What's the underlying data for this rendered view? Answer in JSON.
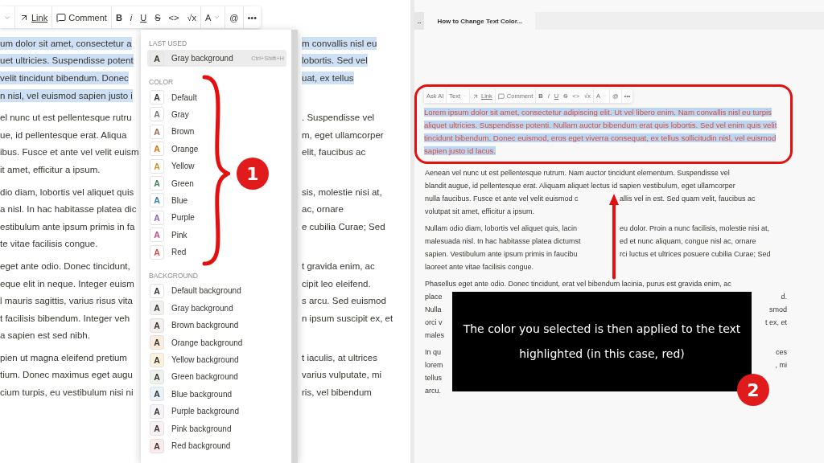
{
  "left_screenshot": {
    "toolbar": [
      [
        {
          "label": "Link",
          "kind": "link"
        }
      ],
      [
        {
          "label": "Comment",
          "kind": "comment"
        }
      ],
      [
        {
          "label": "B",
          "kind": "bold"
        },
        {
          "label": "i",
          "kind": "italic"
        },
        {
          "label": "U",
          "kind": "underline"
        },
        {
          "label": "S",
          "kind": "strike"
        },
        {
          "label": "<>",
          "kind": "plain"
        },
        {
          "label": "√x",
          "kind": "plain"
        }
      ],
      [
        {
          "label": "A",
          "kind": "dropdown"
        }
      ],
      [
        {
          "label": "@",
          "kind": "plain"
        }
      ],
      [
        {
          "label": "•••",
          "kind": "plain"
        }
      ]
    ],
    "paragraphs": [
      {
        "selected": true,
        "lines": [
          {
            "left": "um dolor sit amet, consectetur a",
            "right": "m convallis nisl eu"
          },
          {
            "left": "uet ultricies. Suspendisse potent",
            "right": "lobortis. Sed vel"
          },
          {
            "left": " velit tincidunt bibendum. Donec",
            "right": "uat, ex tellus"
          },
          {
            "left": "n nisl, vel euismod sapien justo i"
          }
        ]
      },
      {
        "selected": false,
        "lines": [
          {
            "left": "el nunc ut est pellentesque rutru",
            "right": ". Suspendisse vel"
          },
          {
            "left": "ue, id pellentesque erat. Aliqua",
            "right": "m, eget ullamcorper"
          },
          {
            "left": "ibus. Fusce et ante vel velit euism",
            "right": "elit, faucibus ac"
          },
          {
            "left": "it amet, efficitur a ipsum."
          }
        ]
      },
      {
        "selected": false,
        "lines": [
          {
            "left": "dio diam, lobortis vel aliquet quis",
            "right": "sis, molestie nisi at,"
          },
          {
            "left": "a nisl. In hac habitasse platea dic",
            "right": "ac, ornare"
          },
          {
            "left": "estibulum ante ipsum primis in fa",
            "right": "e cubilia Curae; Sed"
          },
          {
            "left": "te vitae facilisis congue."
          }
        ]
      },
      {
        "selected": false,
        "lines": [
          {
            "left": "eget ante odio. Donec tincidunt,",
            "right": "t gravida enim, ac"
          },
          {
            "left": "eque elit in neque. Integer euism",
            "right": "cipit leo eleifend."
          },
          {
            "left": "l mauris sagittis, varius risus vita",
            "right": "s arcu. Sed euismod"
          },
          {
            "left": "t facilisis bibendum. Integer veh",
            "right": "n ipsum suscipit ex, et"
          },
          {
            "left": "a sapien est sed nibh."
          }
        ]
      },
      {
        "selected": false,
        "lines": [
          {
            "left": "pien ut magna eleifend pretium",
            "right": "t iaculis, at ultrices"
          },
          {
            "left": "tium. Donec maximus eget augu",
            "right": "varius vulputate, mi"
          },
          {
            "left": "cium turpis, eu vestibulum nisi ni",
            "right": "ris, vel bibendum"
          }
        ]
      }
    ],
    "menu": {
      "sections": [
        {
          "heading": "LAST USED",
          "items": [
            {
              "swatch": "A",
              "label": "Gray background",
              "shortcut": "Ctrl+Shift+H",
              "kind": "background",
              "color": "#ebebe9",
              "selected": true
            }
          ]
        },
        {
          "heading": "COLOR",
          "items": [
            {
              "swatch": "A",
              "label": "Default",
              "kind": "text",
              "color": "#37352f",
              "selected": false
            },
            {
              "swatch": "A",
              "label": "Gray",
              "kind": "text",
              "color": "#787774",
              "selected": false
            },
            {
              "swatch": "A",
              "label": "Brown",
              "kind": "text",
              "color": "#9f6b53",
              "selected": false
            },
            {
              "swatch": "A",
              "label": "Orange",
              "kind": "text",
              "color": "#d9730d",
              "selected": false
            },
            {
              "swatch": "A",
              "label": "Yellow",
              "kind": "text",
              "color": "#cb912f",
              "selected": false
            },
            {
              "swatch": "A",
              "label": "Green",
              "kind": "text",
              "color": "#448361",
              "selected": false
            },
            {
              "swatch": "A",
              "label": "Blue",
              "kind": "text",
              "color": "#337ea9",
              "selected": false
            },
            {
              "swatch": "A",
              "label": "Purple",
              "kind": "text",
              "color": "#9065b0",
              "selected": false
            },
            {
              "swatch": "A",
              "label": "Pink",
              "kind": "text",
              "color": "#c14c8a",
              "selected": false
            },
            {
              "swatch": "A",
              "label": "Red",
              "kind": "text",
              "color": "#d44c47",
              "selected": false
            }
          ]
        },
        {
          "heading": "BACKGROUND",
          "items": [
            {
              "swatch": "A",
              "label": "Default background",
              "kind": "background",
              "color": "#ffffff",
              "selected": false
            },
            {
              "swatch": "A",
              "label": "Gray background",
              "kind": "background",
              "color": "#f1f1ef",
              "selected": false
            },
            {
              "swatch": "A",
              "label": "Brown background",
              "kind": "background",
              "color": "#f4eeee",
              "selected": false
            },
            {
              "swatch": "A",
              "label": "Orange background",
              "kind": "background",
              "color": "#fbecdd",
              "selected": false
            },
            {
              "swatch": "A",
              "label": "Yellow background",
              "kind": "background",
              "color": "#fbf3db",
              "selected": false
            },
            {
              "swatch": "A",
              "label": "Green background",
              "kind": "background",
              "color": "#edf3ec",
              "selected": false
            },
            {
              "swatch": "A",
              "label": "Blue background",
              "kind": "background",
              "color": "#e7f3f8",
              "selected": false
            },
            {
              "swatch": "A",
              "label": "Purple background",
              "kind": "background",
              "color": "#f6f3f9",
              "selected": false
            },
            {
              "swatch": "A",
              "label": "Pink background",
              "kind": "background",
              "color": "#faf1f5",
              "selected": false
            },
            {
              "swatch": "A",
              "label": "Red background",
              "kind": "background",
              "color": "#fdebec",
              "selected": false
            }
          ]
        }
      ]
    },
    "badge": "1"
  },
  "right_screenshot": {
    "tabs": [
      {
        "label": "..",
        "selected": false
      },
      {
        "label": "How to Change Text Color...",
        "selected": true
      }
    ],
    "toolbar": [
      [
        {
          "label": "Ask AI",
          "kind": "plain"
        }
      ],
      [
        {
          "label": "Text",
          "kind": "dropdown"
        }
      ],
      [
        {
          "label": "Link",
          "kind": "link"
        }
      ],
      [
        {
          "label": "Comment",
          "kind": "comment"
        }
      ],
      [
        {
          "label": "B",
          "kind": "bold"
        },
        {
          "label": "I",
          "kind": "italic"
        },
        {
          "label": "U",
          "kind": "underline"
        },
        {
          "label": "S",
          "kind": "strike"
        },
        {
          "label": "<>",
          "kind": "plain"
        },
        {
          "label": "√x",
          "kind": "plain"
        }
      ],
      [
        {
          "label": "A",
          "kind": "dropdown"
        }
      ],
      [
        {
          "label": "@",
          "kind": "plain"
        }
      ],
      [
        {
          "label": "•••",
          "kind": "plain"
        }
      ]
    ],
    "highlighted_paragraph": {
      "text": "Lorem ipsum dolor sit amet, consectetur adipiscing elit. Ut vel libero enim. Nam convallis nisl eu turpis aliquet ultricies. Suspendisse potenti. Nullam auctor bibendum erat quis lobortis. Sed vel enim quis velit tincidunt bibendum. Donec euismod, eros eget viverra consequat, ex tellus sollicitudin nisl, vel euismod sapien justo id lacus.",
      "color": "#d44c47"
    },
    "paragraphs": [
      {
        "lines": [
          {
            "left": "Aenean vel nunc ut est pellentesque rutrum. Nam auctor tincidunt elementum. Suspendisse vel"
          },
          {
            "left": "blandit augue, id pellentesque erat. Aliquam aliquet lectus id sapien vestibulum, eget ullamcorper"
          },
          {
            "left": "nulla faucibus. Fusce et ante vel velit euismod c",
            "right": "allis vel in est. Sed quam velit, faucibus ac"
          },
          {
            "left": "volutpat sit amet, efficitur a ipsum."
          }
        ]
      },
      {
        "lines": [
          {
            "left": "Nullam odio diam, lobortis vel aliquet quis, lacin",
            "right": "eu dolor. Proin a nunc facilisis, molestie nisi at,"
          },
          {
            "left": "malesuada nisl. In hac habitasse platea dictumst",
            "right": "ed et nunc aliquam, congue nisl ac, ornare"
          },
          {
            "left": "sapien. Vestibulum ante ipsum primis in faucibu",
            "right": "rci luctus et ultrices posuere cubilia Curae; Sed"
          },
          {
            "left": "laoreet ante vitae facilisis congue."
          }
        ]
      }
    ],
    "covered_paragraphs": [
      {
        "lines": [
          {
            "left": "Phasellus eget ante odio. Donec tincidunt, erat vel bibendum lacinia, purus est gravida enim, ac"
          },
          {
            "left": "place",
            "right": "d."
          },
          {
            "left": "Nulla",
            "right": "smod"
          },
          {
            "left": "orci v",
            "right": "t ex, et"
          },
          {
            "left": "males"
          }
        ]
      },
      {
        "lines": [
          {
            "left": "In qu",
            "right": "ces"
          },
          {
            "left": "lorem",
            "right": ", mi"
          },
          {
            "left": "tellus"
          },
          {
            "left": "arcu."
          }
        ]
      }
    ],
    "caption": {
      "text": "The color you selected is then applied to the text highlighted (in this case, red)",
      "badge": "2"
    }
  }
}
